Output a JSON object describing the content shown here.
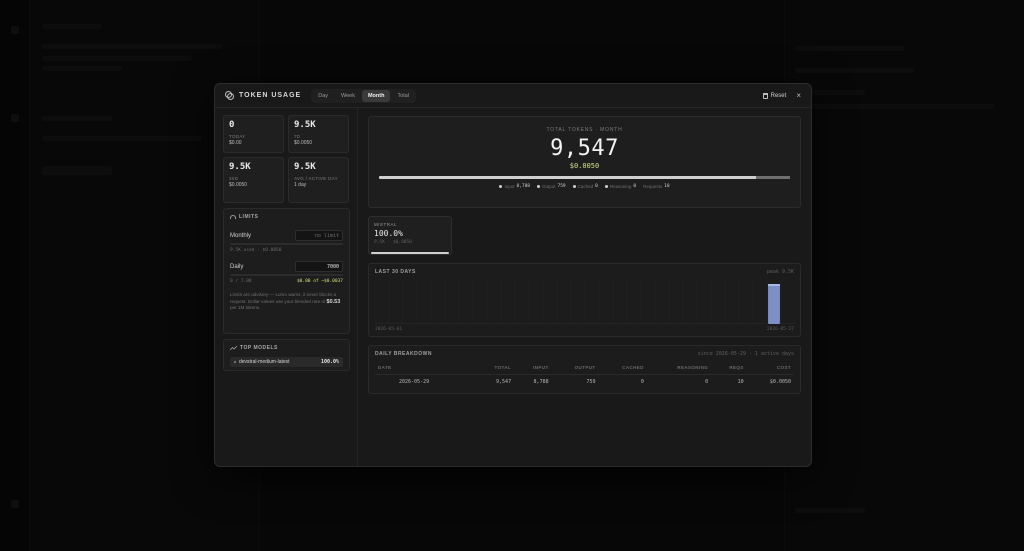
{
  "modal": {
    "title": "TOKEN USAGE",
    "tabs": [
      {
        "label": "Day"
      },
      {
        "label": "Week"
      },
      {
        "label": "Month",
        "active": true
      },
      {
        "label": "Total"
      }
    ],
    "reset_label": "Reset",
    "close_label": "×"
  },
  "stats": [
    {
      "value": "0",
      "label": "TODAY",
      "sub": "$0.00"
    },
    {
      "value": "9.5K",
      "label": "7D",
      "sub": "$0.0050"
    },
    {
      "value": "9.5K",
      "label": "30D",
      "sub": "$0.0050"
    },
    {
      "value": "9.5K",
      "label": "AVG / ACTIVE DAY",
      "sub": "1 day"
    }
  ],
  "limits": {
    "title": "LIMITS",
    "monthly": {
      "label": "Monthly",
      "placeholder": "no limit",
      "note": "9.5K used · $0.0050"
    },
    "daily": {
      "label": "Daily",
      "value": "7000",
      "note_left": "0 / 7.0K",
      "note_right": "$0.00 of ~$0.0037"
    },
    "advisory_pre": "Limits are advisory — Lumo warns, it never blocks a request. Dollar values use your blended rate of",
    "advisory_rate": "$0.53",
    "advisory_post": "per 1M tokens."
  },
  "top_models": {
    "title": "TOP MODELS",
    "items": [
      {
        "name": "devstral-medium-latest",
        "pct": "100.0%"
      }
    ]
  },
  "total": {
    "label": "TOTAL TOKENS · MONTH",
    "value": "9,547",
    "cost": "$0.0050",
    "input_fraction": 0.9177,
    "legend": [
      {
        "label": "Input",
        "value": "8,788"
      },
      {
        "label": "Output",
        "value": "759"
      },
      {
        "label": "Cached",
        "value": "0"
      },
      {
        "label": "Reasoning",
        "value": "0"
      },
      {
        "label": "Requests",
        "value": "10"
      }
    ]
  },
  "provider": {
    "name": "MISTRAL",
    "pct": "100.0%",
    "sub": "9.5K · $0.0050"
  },
  "chart": {
    "title": "LAST 30 DAYS",
    "peak_label": "peak 9.5K",
    "x_start": "2026-05-01",
    "x_end": "2026-05-27",
    "colors": {
      "bar": "#7d8fc4",
      "bar_top": "#a9b8e6"
    }
  },
  "chart_data": {
    "type": "bar",
    "title": "LAST 30 DAYS",
    "categories": [
      "d1",
      "d2",
      "d3",
      "d4",
      "d5",
      "d6",
      "d7",
      "d8",
      "d9",
      "d10",
      "d11",
      "d12",
      "d13",
      "d14",
      "d15",
      "d16",
      "d17",
      "d18",
      "d19",
      "d20",
      "d21",
      "d22",
      "d23",
      "d24",
      "d25",
      "d26",
      "d27",
      "d28",
      "d29",
      "d30"
    ],
    "values": [
      0,
      0,
      0,
      0,
      0,
      0,
      0,
      0,
      0,
      0,
      0,
      0,
      0,
      0,
      0,
      0,
      0,
      0,
      0,
      0,
      0,
      0,
      0,
      0,
      0,
      0,
      0,
      0,
      9547,
      0
    ],
    "ylim": [
      0,
      9547
    ]
  },
  "breakdown": {
    "title": "DAILY BREAKDOWN",
    "subtitle": "since 2026-05-29 · 1 active days",
    "columns": [
      "DATE",
      "TOTAL",
      "INPUT",
      "OUTPUT",
      "CACHED",
      "REASONING",
      "REQS",
      "COST"
    ],
    "rows": [
      [
        "2026-05-29",
        "9,547",
        "8,788",
        "759",
        "0",
        "0",
        "10",
        "$0.0050"
      ]
    ]
  }
}
